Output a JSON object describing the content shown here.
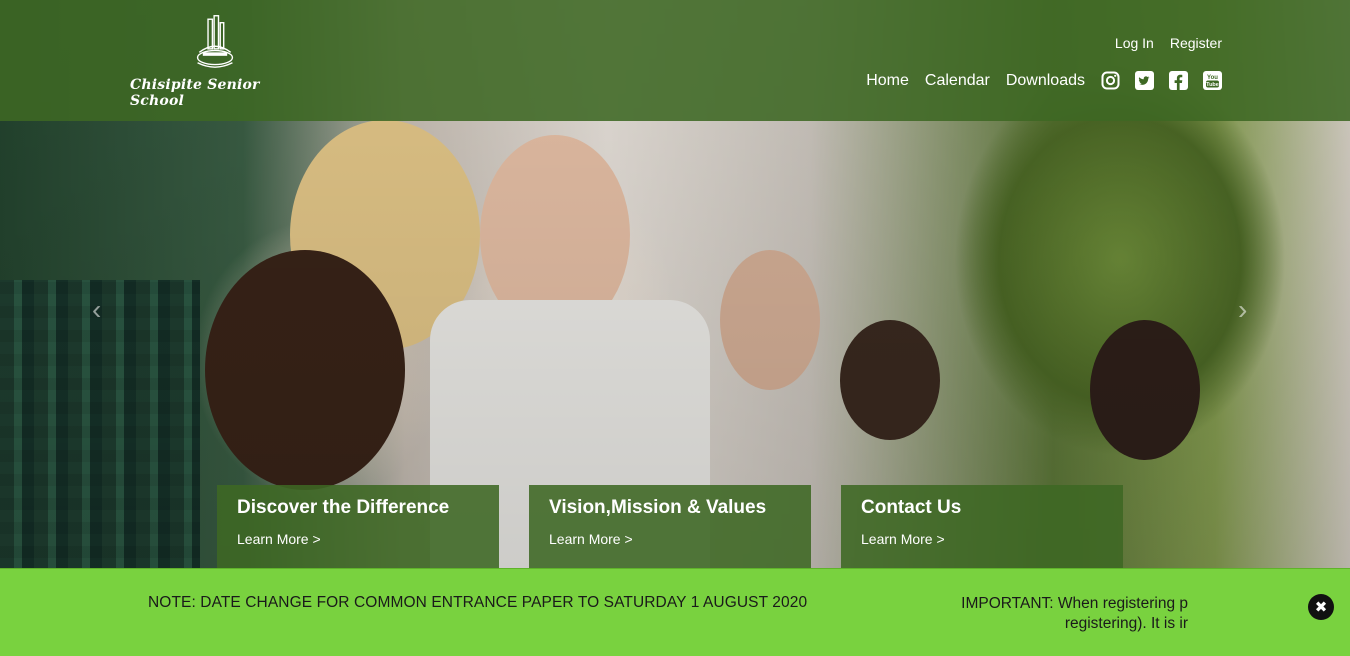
{
  "site": {
    "name": "Chisipite Senior School"
  },
  "header": {
    "top_links": [
      "Log In",
      "Register"
    ],
    "nav": [
      "Home",
      "Calendar",
      "Downloads"
    ],
    "social": [
      "instagram-icon",
      "twitter-icon",
      "facebook-icon",
      "youtube-icon"
    ]
  },
  "hero": {
    "prev_label": "‹",
    "next_label": "›"
  },
  "cards": [
    {
      "title": "Discover the Difference",
      "link": "Learn More >"
    },
    {
      "title": "Vision,Mission & Values",
      "link": "Learn More >"
    },
    {
      "title": "Contact Us",
      "link": "Learn More >"
    }
  ],
  "notice": {
    "primary": "NOTE: DATE CHANGE FOR COMMON ENTRANCE PAPER TO SATURDAY 1 AUGUST 2020",
    "ticker_line1": "IMPORTANT: When registering p",
    "ticker_line2": "registering). It is ir",
    "close_label": "✖"
  },
  "colors": {
    "header_green": "#3d6823",
    "notice_green": "#79d23f"
  }
}
